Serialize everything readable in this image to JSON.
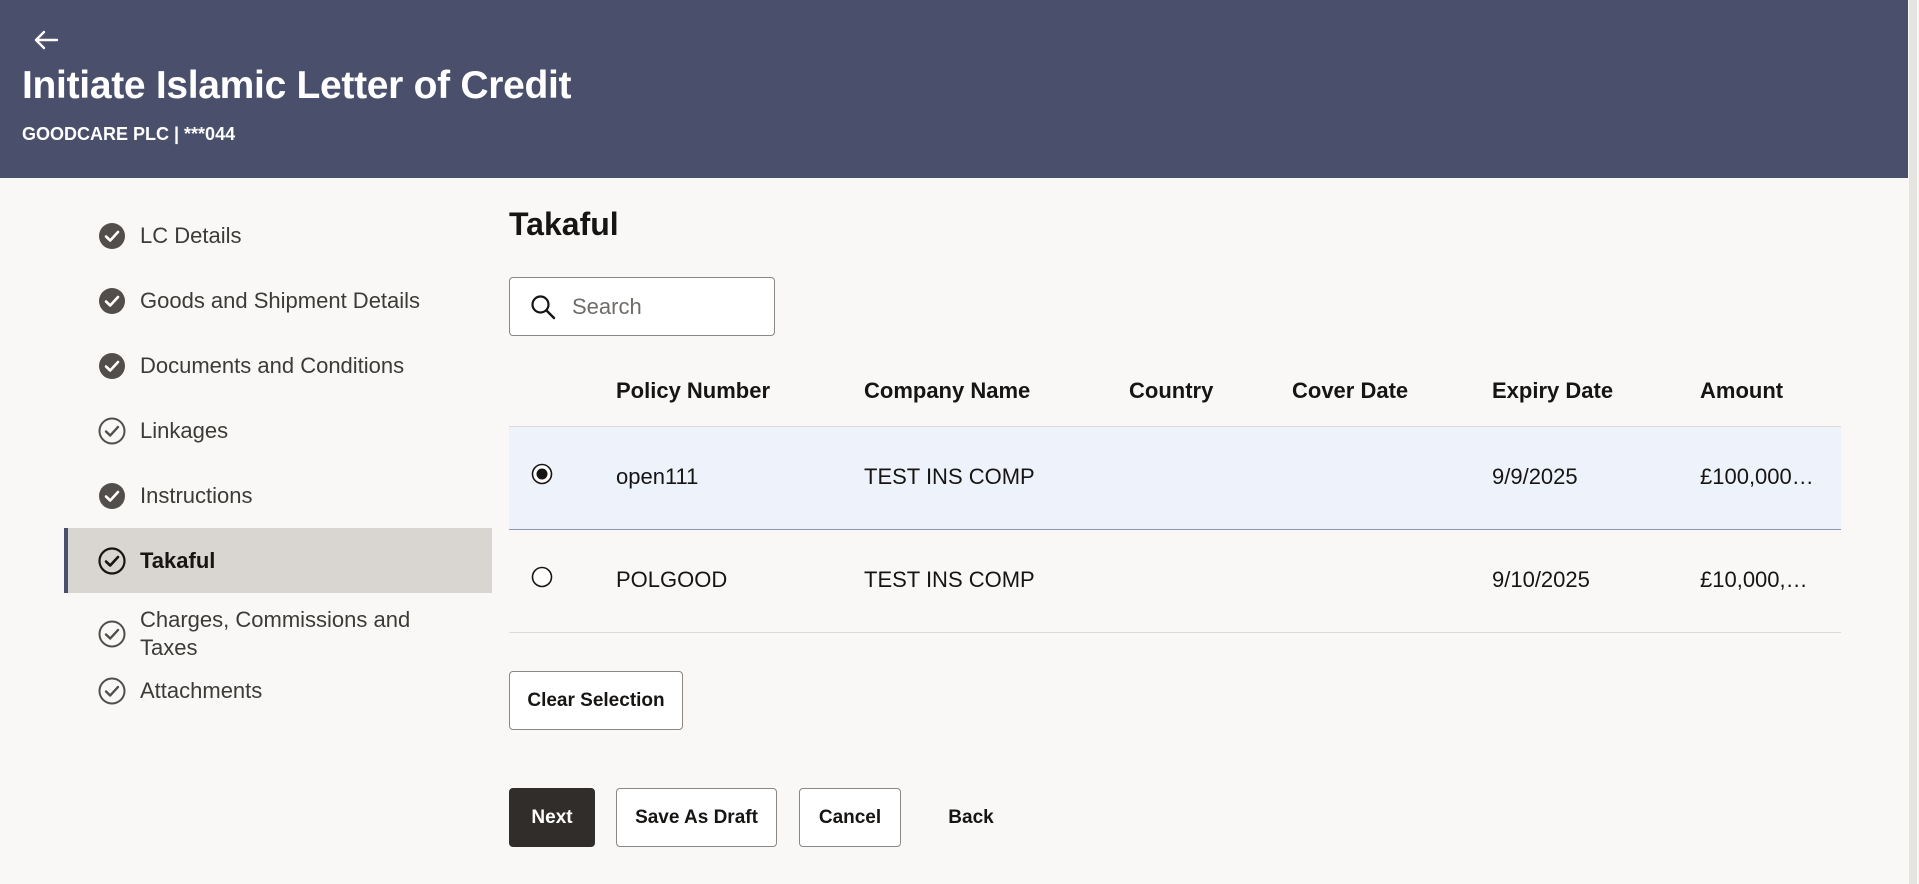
{
  "header": {
    "title": "Initiate Islamic Letter of Credit",
    "subtitle": "GOODCARE PLC | ***044",
    "background": "#4a4f6c"
  },
  "sidebar": {
    "steps": [
      {
        "label": "LC Details",
        "state": "complete"
      },
      {
        "label": "Goods and Shipment Details",
        "state": "complete"
      },
      {
        "label": "Documents and Conditions",
        "state": "complete"
      },
      {
        "label": "Linkages",
        "state": "incomplete"
      },
      {
        "label": "Instructions",
        "state": "complete"
      },
      {
        "label": "Takaful",
        "state": "active"
      },
      {
        "label": "Charges, Commissions and Taxes",
        "state": "incomplete"
      },
      {
        "label": "Attachments",
        "state": "incomplete"
      }
    ]
  },
  "main": {
    "section_title": "Takaful",
    "search": {
      "placeholder": "Search",
      "value": ""
    },
    "table": {
      "columns": [
        "Policy Number",
        "Company Name",
        "Country",
        "Cover Date",
        "Expiry Date",
        "Amount"
      ],
      "rows": [
        {
          "selected": true,
          "policy_number": "open111",
          "company_name": "TEST INS COMP",
          "country": "",
          "cover_date": "",
          "expiry_date": "9/9/2025",
          "amount": "£100,000…"
        },
        {
          "selected": false,
          "policy_number": "POLGOOD",
          "company_name": "TEST INS COMP",
          "country": "",
          "cover_date": "",
          "expiry_date": "9/10/2025",
          "amount": "£10,000,…"
        }
      ]
    },
    "clear_selection_label": "Clear Selection",
    "actions": {
      "next": "Next",
      "save_as_draft": "Save As Draft",
      "cancel": "Cancel",
      "back": "Back"
    }
  }
}
